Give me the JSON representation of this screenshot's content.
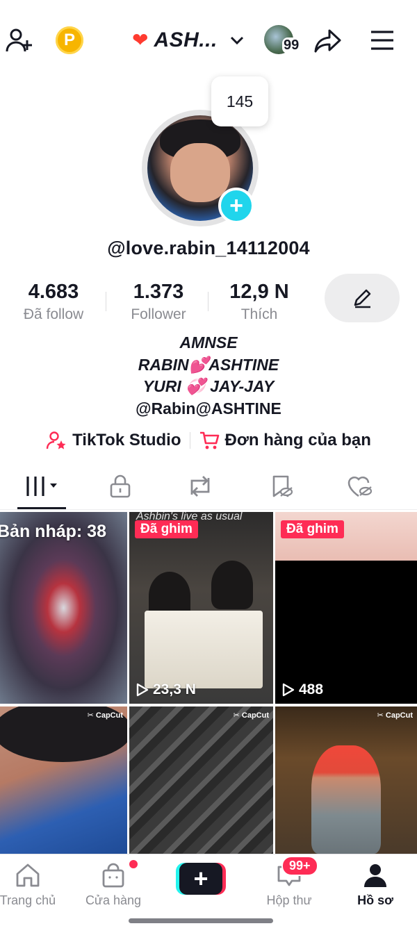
{
  "header": {
    "account_name": "ASH...",
    "coin_letter": "P",
    "friends_count": "99",
    "icons": [
      "add-friend-icon",
      "coin-icon",
      "flame-heart-icon",
      "chevron-down-icon",
      "share-icon",
      "menu-icon"
    ]
  },
  "profile": {
    "new_activity_count": "145",
    "username": "@love.rabin_14112004",
    "stats": [
      {
        "value": "4.683",
        "label": "Đã follow"
      },
      {
        "value": "1.373",
        "label": "Follower"
      },
      {
        "value": "12,9 N",
        "label": "Thích"
      }
    ],
    "bio": [
      "AMNSE",
      "RABIN💕ASHTINE",
      "YURI 💞 JAY-JAY",
      "@Rabin@ASHTINE"
    ]
  },
  "links": {
    "studio": "TikTok Studio",
    "orders": "Đơn hàng của bạn"
  },
  "tabs": [
    "videos-tab",
    "private-tab",
    "reposts-tab",
    "favorites-tab",
    "liked-tab"
  ],
  "grid": {
    "draft_label": "Bản nháp: 38",
    "pinned_label": "Đã ghim",
    "item2_caption": "Ashbin's live as usual",
    "item2_views": "23,3 N",
    "item3_views": "488",
    "capcut_label": "CapCut"
  },
  "nav": {
    "home": "Trang chủ",
    "shop": "Cửa hàng",
    "inbox": "Hộp thư",
    "inbox_badge": "99+",
    "profile": "Hồ sơ"
  },
  "colors": {
    "accent_red": "#fe2c55",
    "accent_cyan": "#25f4ee",
    "text_primary": "#161823",
    "text_secondary": "#8a8b91"
  }
}
